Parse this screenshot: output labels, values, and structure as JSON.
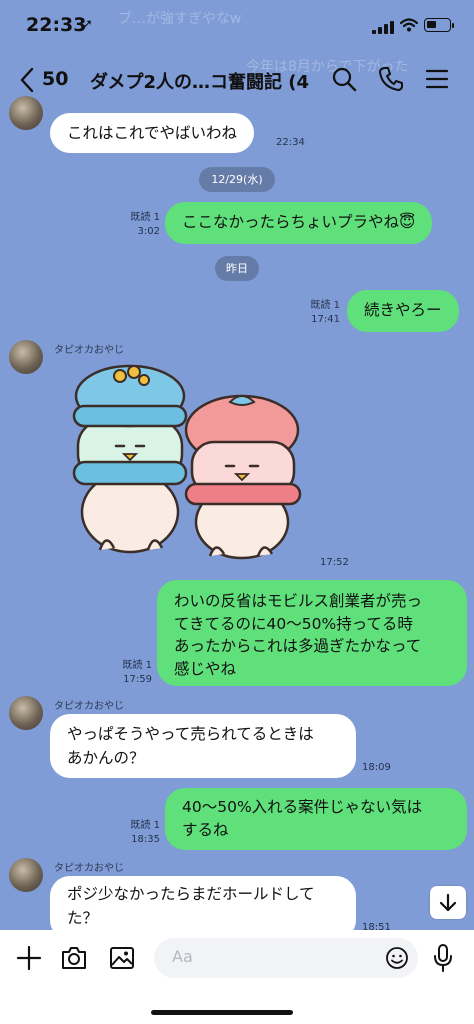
{
  "status_bar": {
    "time": "22:33",
    "ghost_notification": "ブ…が強すぎやなw",
    "ghost_notification_right": "今年は8月からで下がった"
  },
  "header": {
    "back_count": "50",
    "title": "ダメプ2人の…コ奮闘記 (4)"
  },
  "messages": [
    {
      "side": "in",
      "text": "これはこれでやばいわね",
      "time": "22:34"
    },
    {
      "type": "date",
      "text": "12/29(水)"
    },
    {
      "side": "out",
      "read": "既読 1",
      "time": "3:02",
      "text": "ここなかったらちょいプラやね😇"
    },
    {
      "type": "date",
      "text": "昨日"
    },
    {
      "side": "out",
      "read": "既読 1",
      "time": "17:41",
      "text": "続きやろー"
    },
    {
      "side": "in",
      "sender": "タピオカおやじ",
      "type": "sticker",
      "time": "17:52"
    },
    {
      "side": "out",
      "read": "既読 1",
      "time": "17:59",
      "lines": [
        "わいの反省はモビルス創業者が売っ",
        "てきてるのに40〜50%持ってる時",
        "あったからこれは多過ぎたかなって",
        "感じやね"
      ]
    },
    {
      "side": "in",
      "sender": "タピオカおやじ",
      "time": "18:09",
      "lines": [
        "やっぱそうやって売られてるときは",
        "あかんの？"
      ]
    },
    {
      "side": "out",
      "read": "既読 1",
      "time": "18:35",
      "lines": [
        "40〜50%入れる案件じゃない気は",
        "するね"
      ]
    },
    {
      "side": "in",
      "sender": "タピオカおやじ",
      "time": "18:51",
      "lines": [
        "ポジ少なかったらまだホールドして",
        "た？"
      ]
    }
  ],
  "input": {
    "placeholder": "Aa"
  },
  "icons": {
    "back": "chevron-left-icon",
    "search": "search-icon",
    "call": "phone-icon",
    "menu": "menu-icon",
    "plus": "plus-icon",
    "camera": "camera-icon",
    "image": "image-icon",
    "emoji": "emoji-icon",
    "mic": "microphone-icon",
    "scroll": "arrow-down-icon"
  },
  "colors": {
    "chat_bg": "#7f9cd6",
    "bubble_out": "#5fe07a",
    "bubble_in": "#ffffff",
    "date_pill": "#647aa6"
  }
}
